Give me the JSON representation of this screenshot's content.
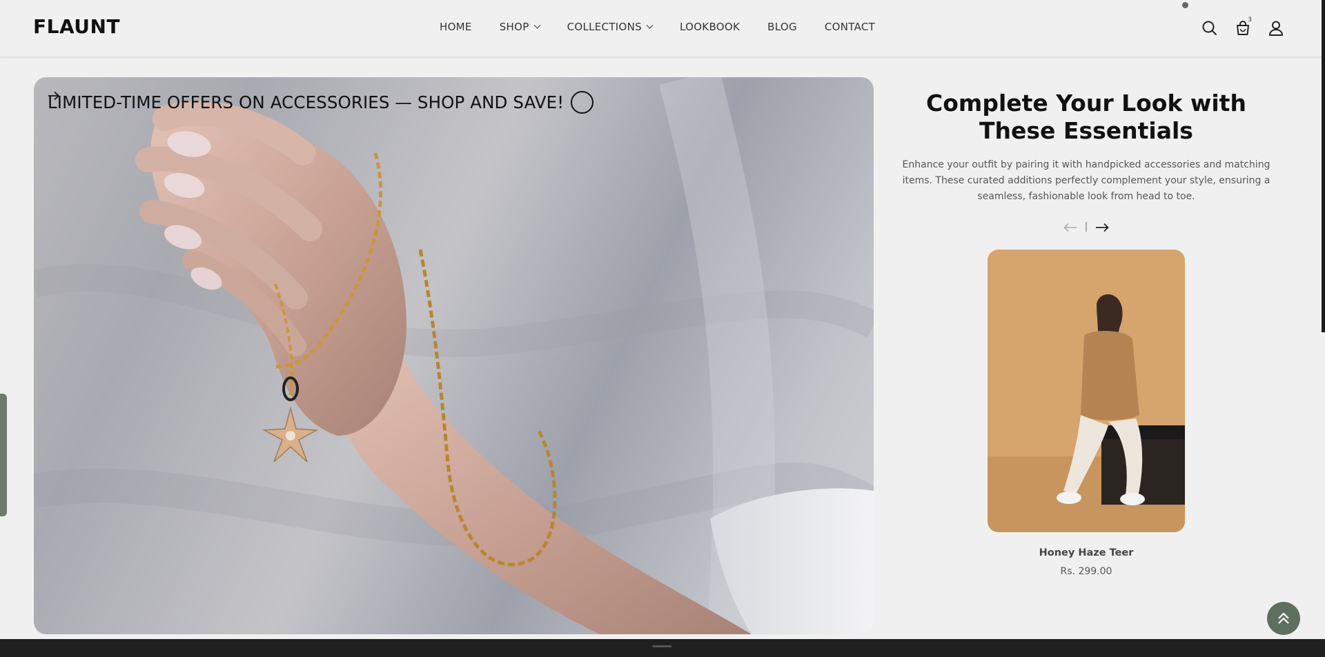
{
  "header": {
    "logo": "FLAUNT",
    "nav": [
      {
        "label": "HOME",
        "dropdown": false
      },
      {
        "label": "SHOP",
        "dropdown": true
      },
      {
        "label": "COLLECTIONS",
        "dropdown": true
      },
      {
        "label": "LOOKBOOK",
        "dropdown": false
      },
      {
        "label": "BLOG",
        "dropdown": false
      },
      {
        "label": "CONTACT",
        "dropdown": false
      }
    ],
    "icons": [
      "search-icon",
      "cart-icon",
      "user-icon"
    ],
    "cart_count": "3"
  },
  "hero": {
    "banner_text": "LIMITED-TIME OFFERS ON ACCESSORIES — SHOP AND SAVE!",
    "arrow_icon": "arrow-right-circle-icon"
  },
  "panel": {
    "title": "Complete Your Look with These Essentials",
    "description": "Enhance your outfit by pairing it with handpicked accessories and matching items. These curated additions perfectly complement your style, ensuring a seamless, fashionable look from head to toe.",
    "pager_separator": "|",
    "product": {
      "name": "Honey Haze Teer",
      "price": "Rs. 299.00"
    }
  },
  "colors": {
    "accent": "#5f6f5f",
    "background": "#f0f0f0",
    "text": "#111111"
  }
}
